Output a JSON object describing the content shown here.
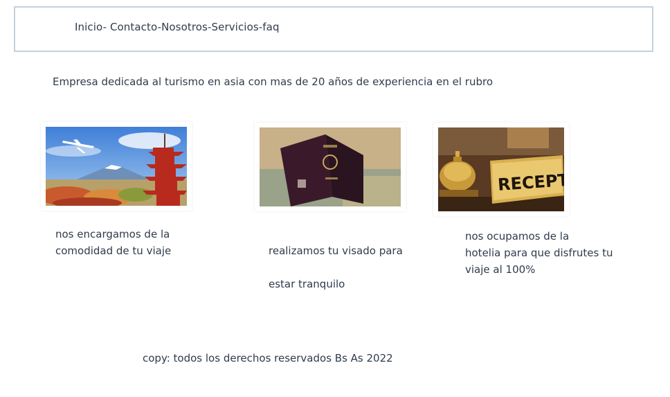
{
  "nav": {
    "text": "Inicio- Contacto-Nosotros-Servicios-faq"
  },
  "intro": {
    "text": "Empresa dedicada al turismo en asia con mas de 20 años de experiencia en el rubro"
  },
  "cards": [
    {
      "image_icon": "airplane-pagoda-mountain-image",
      "lines": [
        "nos encargamos de la",
        "comodidad de tu viaje"
      ]
    },
    {
      "image_icon": "passport-image",
      "lines": [
        "realizamos tu visado para",
        "estar tranquilo"
      ]
    },
    {
      "image_icon": "reception-bell-image",
      "sign_text": "RECEPTION",
      "lines": [
        "nos ocupamos de la",
        "hotelia para que disfrutes tu",
        "viaje al 100%"
      ]
    }
  ],
  "footer": {
    "copy": "copy: todos los derechos reservados Bs As 2022"
  }
}
